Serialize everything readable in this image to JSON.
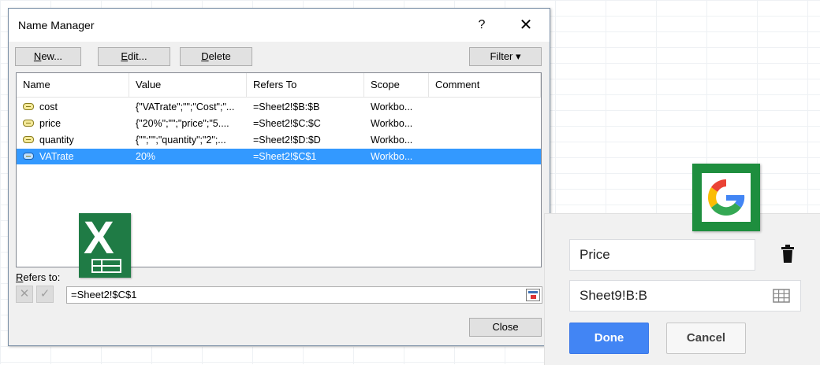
{
  "dialog": {
    "title": "Name Manager",
    "help_label": "?",
    "close_label": "✕",
    "buttons": {
      "new": {
        "label_u": "N",
        "label_rest": "ew..."
      },
      "edit": {
        "label_u": "E",
        "label_rest": "dit..."
      },
      "delete": {
        "label_u": "D",
        "label_rest": "elete"
      },
      "filter": "Filter ▾",
      "close": "Close"
    },
    "columns": [
      "Name",
      "Value",
      "Refers To",
      "Scope",
      "Comment"
    ],
    "rows": [
      {
        "name": "cost",
        "value": "{\"VATrate\";\"\";\"Cost\";\"...",
        "refers_to": "=Sheet2!$B:$B",
        "scope": "Workbo...",
        "comment": "",
        "selected": false
      },
      {
        "name": "price",
        "value": "{\"20%\";\"\";\"price\";\"5....",
        "refers_to": "=Sheet2!$C:$C",
        "scope": "Workbo...",
        "comment": "",
        "selected": false
      },
      {
        "name": "quantity",
        "value": "{\"\";\"\";\"quantity\";\"2\";...",
        "refers_to": "=Sheet2!$D:$D",
        "scope": "Workbo...",
        "comment": "",
        "selected": false
      },
      {
        "name": "VATrate",
        "value": "20%",
        "refers_to": "=Sheet2!$C$1",
        "scope": "Workbo...",
        "comment": "",
        "selected": true
      }
    ],
    "refers_to_label_u": "R",
    "refers_to_label_rest": "efers to:",
    "refers_to_value": "=Sheet2!$C$1",
    "cancel_icon_glyph": "✕",
    "confirm_icon_glyph": "✓"
  },
  "google_panel": {
    "name_value": "Price",
    "range_value": "Sheet9!B:B",
    "done_label": "Done",
    "cancel_label": "Cancel",
    "brand_colors": {
      "blue": "#4285f4",
      "red": "#ea4335",
      "yellow": "#fbbc05",
      "green": "#34a853"
    }
  },
  "logos": {
    "excel_letter": "X",
    "excel_color": "#1f7b45",
    "sheets_color": "#1e8e3e"
  }
}
